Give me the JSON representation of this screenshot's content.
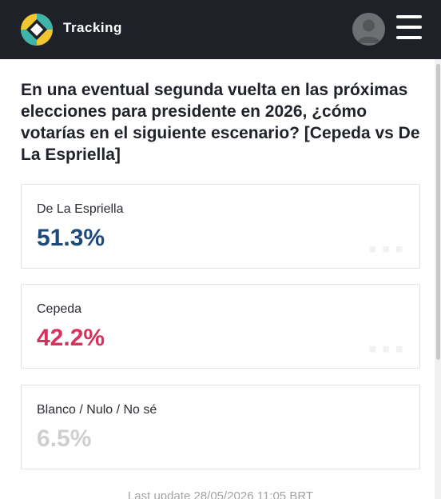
{
  "header": {
    "brand": "Tracking",
    "colors": {
      "background": "#1e2128",
      "logo_yellow": "#f1c62f",
      "logo_teal": "#3fb5a9"
    }
  },
  "question": {
    "text": "En una eventual segunda vuelta en las próximas elecciones para presidente en 2026, ¿cómo votarías en el siguiente escenario? [Cepeda vs De La Espriella]"
  },
  "results": [
    {
      "label": "De La Espriella",
      "value": "51.3%",
      "color": "#1d4a7a"
    },
    {
      "label": "Cepeda",
      "value": "42.2%",
      "color": "#d5325e"
    },
    {
      "label": "Blanco / Nulo / No sé",
      "value": "6.5%",
      "color": "#cfcfd2"
    }
  ],
  "footer": {
    "last_update": "Last update 28/05/2026 11:05 BRT"
  },
  "icons": {
    "logo": "tracking-logo-icon",
    "avatar": "user-avatar-icon",
    "menu": "hamburger-menu-icon"
  }
}
